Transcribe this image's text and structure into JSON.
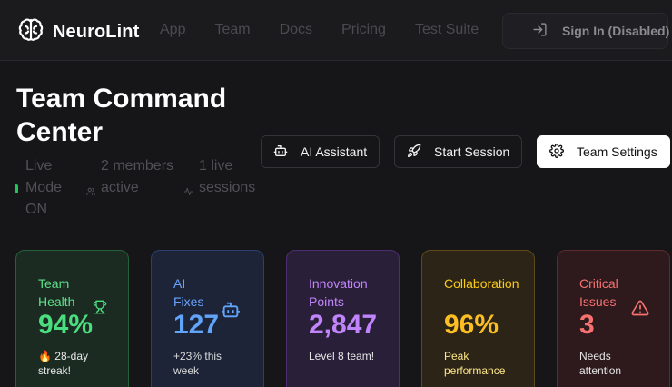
{
  "brand": {
    "name": "NeuroLint",
    "icon": "brain-icon"
  },
  "nav": [
    "App",
    "Team",
    "Docs",
    "Pricing",
    "Test Suite"
  ],
  "signin": {
    "label": "Sign In (Disabled)",
    "icon": "log-in-icon"
  },
  "header": {
    "title": "Team Command Center",
    "status": [
      {
        "text": "Live Mode ON",
        "icon": "live-dot",
        "color": "#22c55e"
      },
      {
        "text": "2 members active",
        "icon": "users-icon"
      },
      {
        "text": "1 live sessions",
        "icon": "activity-icon"
      }
    ],
    "actions": {
      "ai_assistant": "AI Assistant",
      "start_session": "Start Session",
      "team_settings": "Team Settings"
    }
  },
  "metrics": [
    {
      "label": "Team Health",
      "value": "94%",
      "sub": "28-day streak!",
      "icon": "trophy-icon",
      "sub_icon": "flame-icon",
      "color": "#4ade80"
    },
    {
      "label": "AI Fixes",
      "value": "127",
      "sub": "+23% this week",
      "icon": "bot-icon",
      "color": "#60a5fa"
    },
    {
      "label": "Innovation Points",
      "value": "2,847",
      "sub": "Level 8 team!",
      "color": "#c084fc"
    },
    {
      "label": "Collaboration",
      "value": "96%",
      "sub": "Peak performance",
      "color": "#fbbf24"
    },
    {
      "label": "Critical Issues",
      "value": "3",
      "sub": "Needs attention",
      "icon": "alert-triangle-icon",
      "color": "#f87171"
    }
  ]
}
